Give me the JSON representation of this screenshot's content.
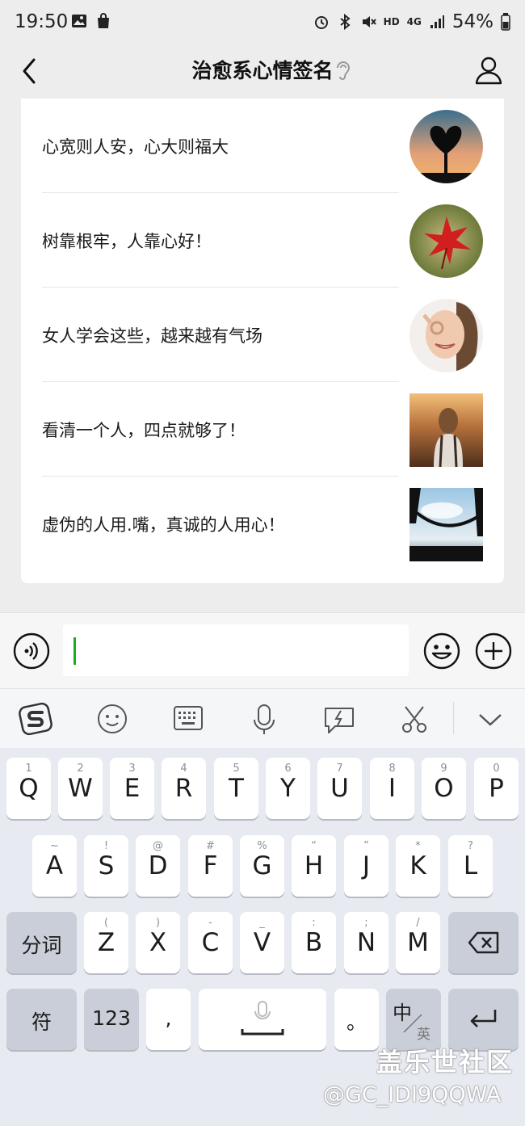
{
  "status_bar": {
    "time": "19:50",
    "network": "4G",
    "hd": "HD",
    "battery": "54%"
  },
  "header": {
    "title": "治愈系心情签名"
  },
  "articles": [
    {
      "title": "心宽则人安，心大则福大",
      "thumb": "heart-tree-sunset"
    },
    {
      "title": "树靠根牢，人靠心好！",
      "thumb": "red-maple-leaf"
    },
    {
      "title": "女人学会这些，越来越有气场",
      "thumb": "smiling-woman"
    },
    {
      "title": "看清一个人，四点就够了！",
      "thumb": "woman-field"
    },
    {
      "title": "虚伪的人用.嘴，真诚的人用心！",
      "thumb": "hammock-sky"
    }
  ],
  "input": {
    "value": ""
  },
  "keyboard": {
    "row1": [
      {
        "hint": "1",
        "key": "Q"
      },
      {
        "hint": "2",
        "key": "W"
      },
      {
        "hint": "3",
        "key": "E"
      },
      {
        "hint": "4",
        "key": "R"
      },
      {
        "hint": "5",
        "key": "T"
      },
      {
        "hint": "6",
        "key": "Y"
      },
      {
        "hint": "7",
        "key": "U"
      },
      {
        "hint": "8",
        "key": "I"
      },
      {
        "hint": "9",
        "key": "O"
      },
      {
        "hint": "0",
        "key": "P"
      }
    ],
    "row2": [
      {
        "hint": "~",
        "key": "A"
      },
      {
        "hint": "!",
        "key": "S"
      },
      {
        "hint": "@",
        "key": "D"
      },
      {
        "hint": "#",
        "key": "F"
      },
      {
        "hint": "%",
        "key": "G"
      },
      {
        "hint": "“",
        "key": "H"
      },
      {
        "hint": "”",
        "key": "J"
      },
      {
        "hint": "*",
        "key": "K"
      },
      {
        "hint": "?",
        "key": "L"
      }
    ],
    "row3": [
      {
        "hint": "(",
        "key": "Z"
      },
      {
        "hint": ")",
        "key": "X"
      },
      {
        "hint": "-",
        "key": "C"
      },
      {
        "hint": "_",
        "key": "V"
      },
      {
        "hint": ":",
        "key": "B"
      },
      {
        "hint": ";",
        "key": "N"
      },
      {
        "hint": "/",
        "key": "M"
      }
    ],
    "fenci_label": "分词",
    "symbol_label": "符",
    "num_label": "123",
    "comma_label": ",",
    "period_label": "。",
    "lang_label_main": "中",
    "lang_label_sub": "英"
  },
  "watermark": {
    "line1": "盖乐世社区",
    "line2": "@GC_IDI9QQWA"
  }
}
